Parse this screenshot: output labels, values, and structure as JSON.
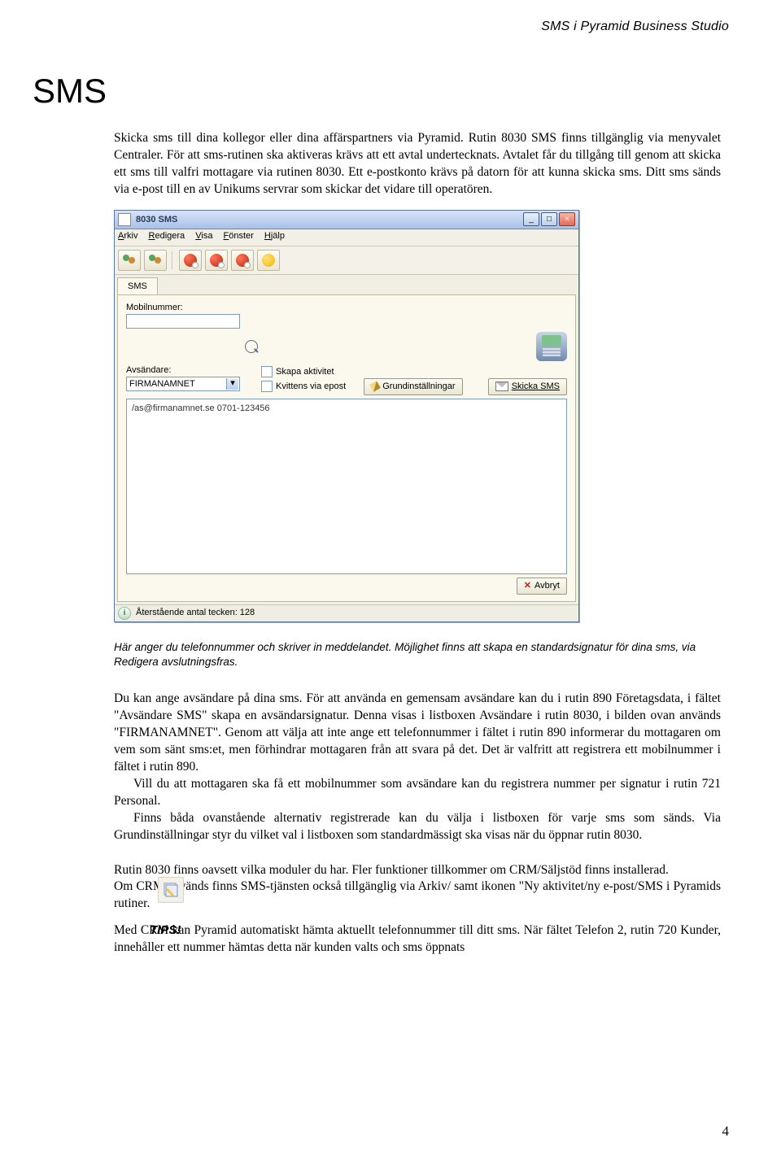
{
  "header": {
    "running_head": "SMS i Pyramid Business Studio"
  },
  "title": "SMS",
  "intro": "Skicka sms till dina kollegor eller dina affärspartners via Pyramid. Rutin 8030 SMS finns tillgänglig via menyvalet Centraler.  För att  sms-rutinen ska aktiveras krävs att ett avtal undertecknats. Avtalet får du tillgång till genom att skicka ett sms till valfri mottagare via rutinen 8030. Ett e-postkonto krävs på datorn för att kunna skicka sms. Ditt sms sänds via e-post till en av Unikums servrar som skickar det vidare till operatören.",
  "screenshot": {
    "title": "8030 SMS",
    "menus": [
      "Arkiv",
      "Redigera",
      "Visa",
      "Fönster",
      "Hjälp"
    ],
    "tab": "SMS",
    "mobil_label": "Mobilnummer:",
    "avsandare_label": "Avsändare:",
    "avsandare_value": "FIRMANAMNET",
    "chk_skapa": "Skapa aktivitet",
    "chk_kvittens": "Kvittens via epost",
    "btn_grund": "Grundinställningar",
    "btn_skicka": "Skicka SMS",
    "message_value": "/as@firmanamnet.se 0701-123456",
    "btn_avbryt": "Avbryt",
    "status": "Återstående antal tecken: 128"
  },
  "caption": "Här anger du telefonnummer och skriver in meddelandet. Möjlighet finns att skapa en standardsignatur för dina sms, via Redigera avslutningsfras.",
  "para2a": "Du kan ange avsändare på dina sms. För att använda en gemensam avsändare kan du  i rutin 890 Företagsdata, i fältet \"Avsändare SMS\" skapa en avsändarsignatur. Denna visas i listboxen Avsändare i rutin 8030, i bilden ovan används \"FIRMANAMNET\". Genom att välja att inte ange ett telefonnummer i fältet i rutin 890 informerar du mottagaren om vem som sänt sms:et, men förhindrar mottagaren från att svara på det. Det är valfritt att registrera ett mobilnummer i fältet i rutin 890.",
  "para2b": "Vill du att mottagaren ska få ett mobilnummer som avsändare kan du registrera nummer per signatur i rutin 721 Personal.",
  "para2c": "Finns båda ovanstående alternativ registrerade kan du välja i listboxen för varje sms som sänds.  Via Grundinställningar styr du vilket val i listboxen som standardmässigt ska visas när du öppnar rutin 8030.",
  "para3a": "Rutin 8030 finns oavsett vilka moduler du har. Fler funktioner tillkommer om CRM/Säljstöd finns installerad.",
  "para3b": "Om CRM används finns SMS-tjänsten också tillgänglig via Arkiv/ samt ikonen \"Ny aktivitet/ny e-post/SMS i Pyramids rutiner.",
  "tips_label": "TIPS!",
  "tips_text": "Med CRM kan Pyramid automatiskt hämta aktuellt telefonnummer till ditt sms. När fältet Telefon 2, rutin 720 Kunder, innehåller ett nummer hämtas detta när kunden valts och sms öppnats",
  "page_number": "4"
}
